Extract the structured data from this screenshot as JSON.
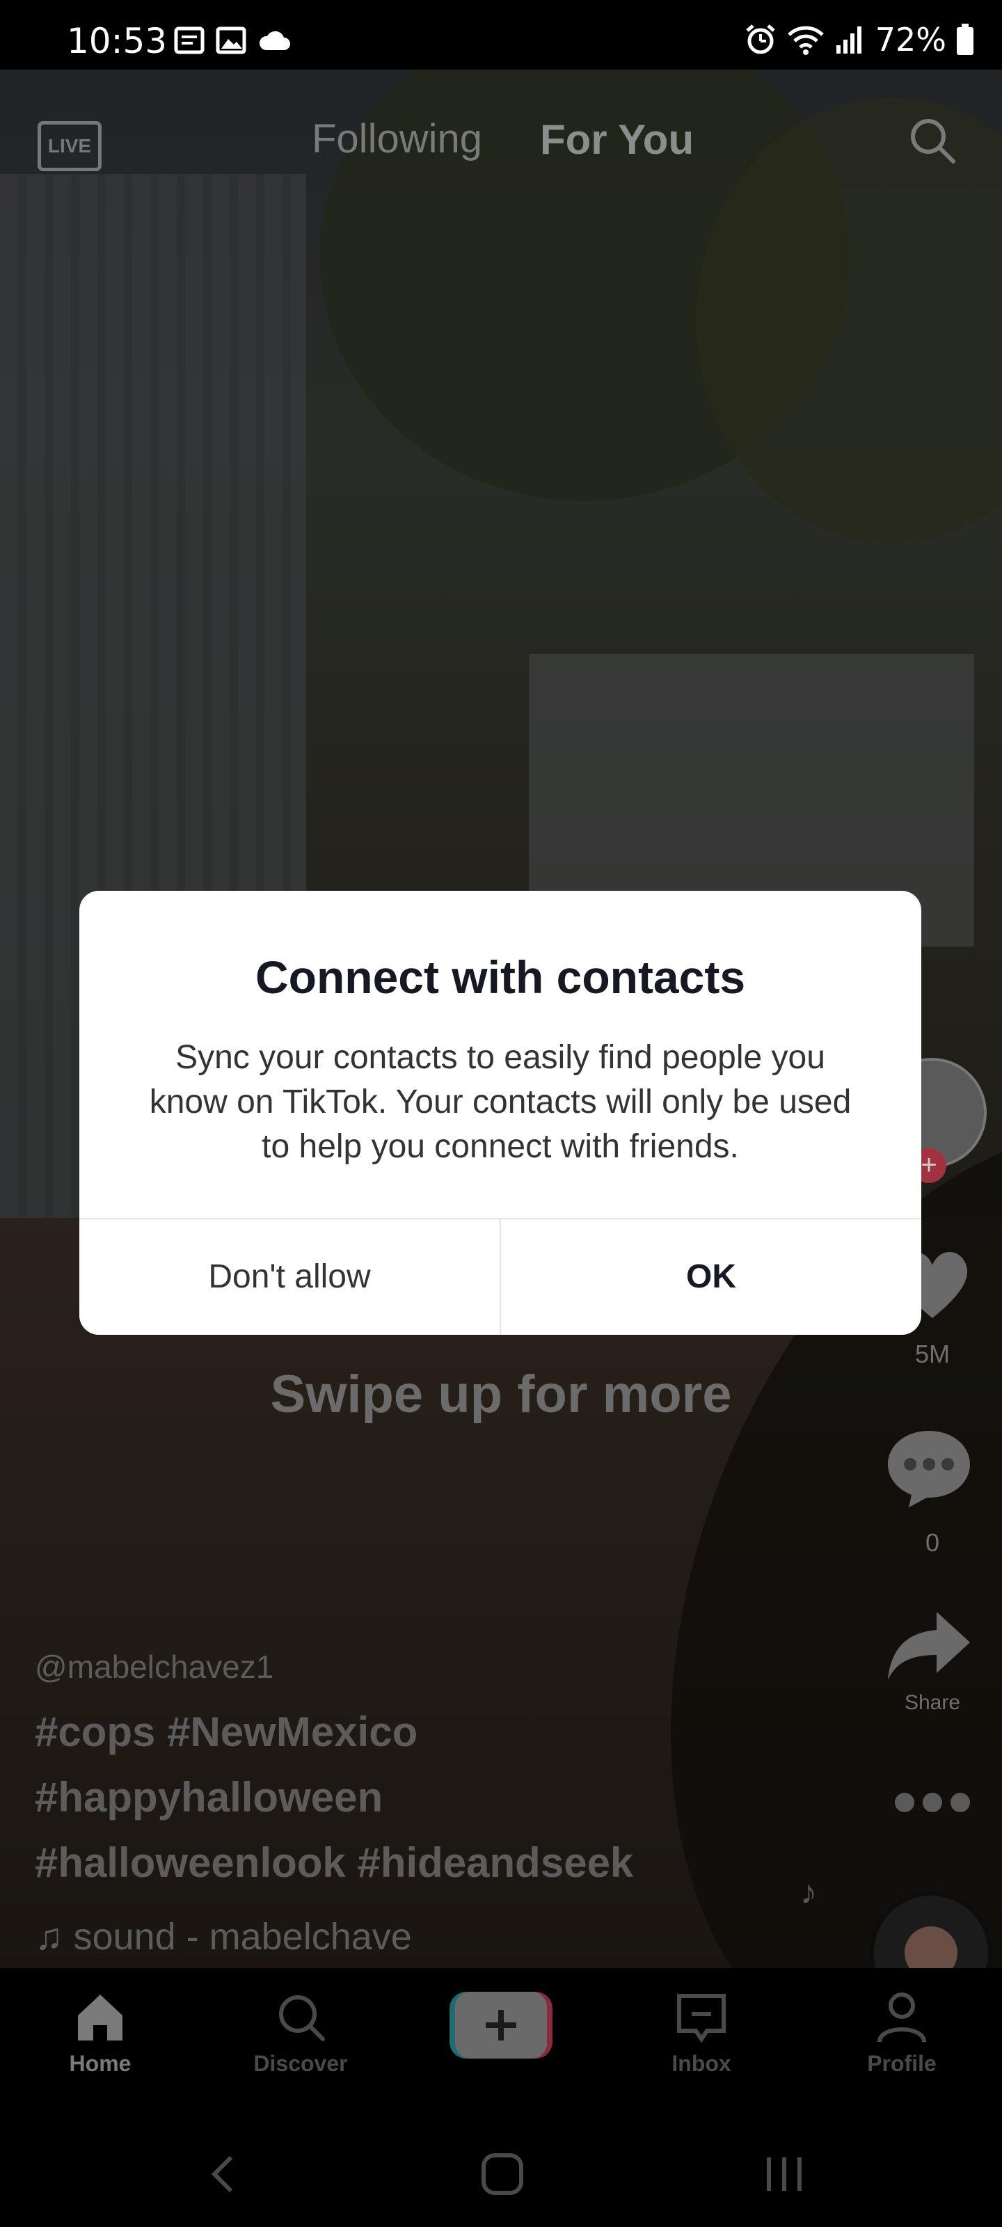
{
  "status_bar": {
    "time": "10:53",
    "battery": "72%",
    "left_icons": [
      "notification-icon",
      "gallery-icon",
      "cloud-icon"
    ],
    "right_icons": [
      "alarm-icon",
      "wifi-icon",
      "signal-icon",
      "battery-icon"
    ]
  },
  "feed": {
    "tabs": [
      {
        "label": "Following",
        "active": false
      },
      {
        "label": "For You",
        "active": true
      }
    ],
    "live_label": "LIVE"
  },
  "video": {
    "username": "@mabelchavez1",
    "hashtags": [
      "#cops #NewMexico",
      "#happyhalloween",
      "#halloweenlook #hideandseek"
    ],
    "sound": "sound - mabelchave",
    "swipe_hint": "Swipe up for more",
    "likes": "5M",
    "comments": "0",
    "share_label": "Share"
  },
  "dialog": {
    "title": "Connect with contacts",
    "body": "Sync your contacts to easily find people you know on TikTok. Your contacts will only be used to help you connect with friends.",
    "deny_label": "Don't allow",
    "ok_label": "OK"
  },
  "bottom_nav": {
    "items": [
      {
        "label": "Home",
        "icon": "home-icon",
        "active": true
      },
      {
        "label": "Discover",
        "icon": "search-icon",
        "active": false
      },
      {
        "label": "",
        "icon": "create-icon",
        "active": false
      },
      {
        "label": "Inbox",
        "icon": "inbox-icon",
        "active": false
      },
      {
        "label": "Profile",
        "icon": "profile-icon",
        "active": false
      }
    ]
  },
  "colors": {
    "dialog_bg": "#ffffff",
    "overlay": "rgba(0,0,0,0.55)",
    "tiktok_red": "#fe2c55",
    "tiktok_cyan": "#25f4ee"
  }
}
